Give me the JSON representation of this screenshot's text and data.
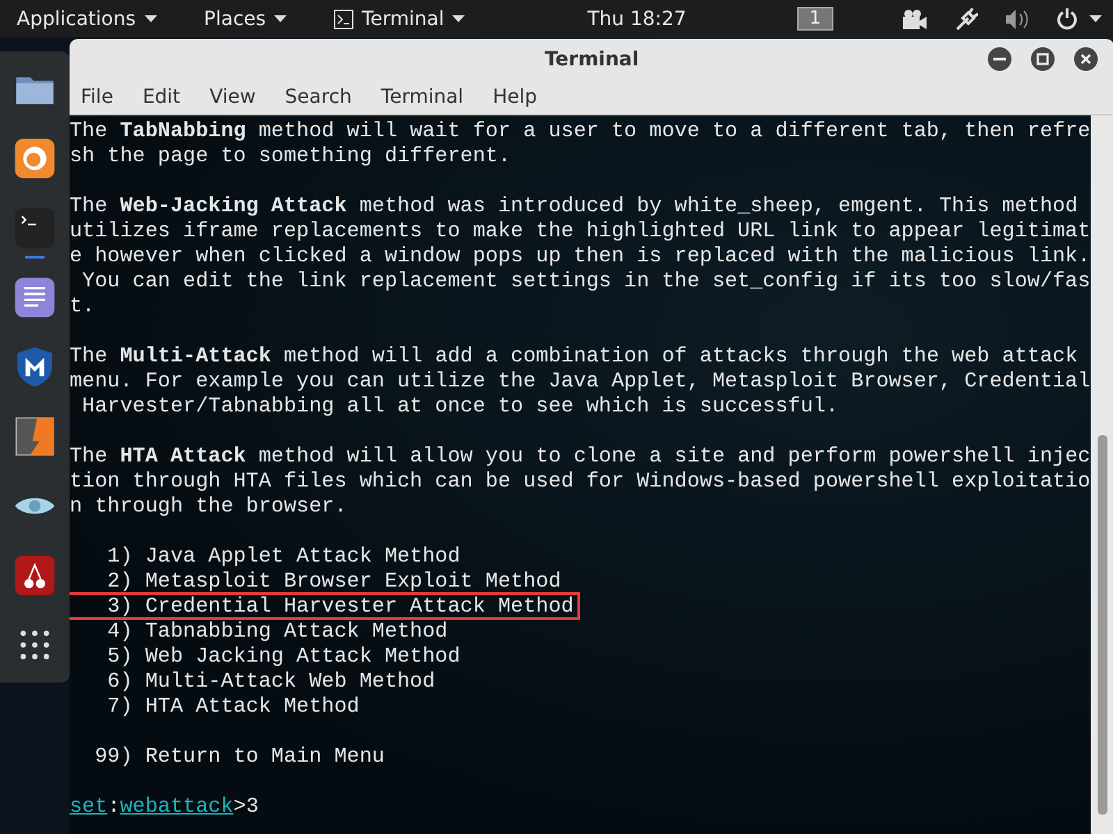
{
  "top_bar": {
    "menus": [
      {
        "label": "Applications",
        "kind": "menu"
      },
      {
        "label": "Places",
        "kind": "menu"
      },
      {
        "label": "Terminal",
        "kind": "app"
      }
    ],
    "clock": "Thu 18:27",
    "workspace": "1"
  },
  "dock": {
    "items": [
      {
        "kind": "folder",
        "running": false
      },
      {
        "kind": "browser",
        "running": false
      },
      {
        "kind": "terminal",
        "running": true
      },
      {
        "kind": "editor",
        "running": false
      },
      {
        "kind": "shield",
        "running": false
      },
      {
        "kind": "bolt",
        "running": false
      },
      {
        "kind": "eye",
        "running": false
      },
      {
        "kind": "cherry",
        "running": false
      },
      {
        "kind": "grid",
        "running": false
      }
    ]
  },
  "window": {
    "title": "Terminal",
    "menu": [
      "File",
      "Edit",
      "View",
      "Search",
      "Terminal",
      "Help"
    ]
  },
  "terminal": {
    "paragraphs": [
      {
        "lines": [
          "The **TabNabbing** method will wait for a user to move to a different tab, then refre",
          "sh the page to something different."
        ]
      },
      {
        "lines": [
          "The **Web-Jacking Attack** method was introduced by white_sheep, emgent. This method",
          "utilizes iframe replacements to make the highlighted URL link to appear legitimat",
          "e however when clicked a window pops up then is replaced with the malicious link.",
          " You can edit the link replacement settings in the set_config if its too slow/fas",
          "t."
        ]
      },
      {
        "lines": [
          "The **Multi-Attack** method will add a combination of attacks through the web attack",
          "menu. For example you can utilize the Java Applet, Metasploit Browser, Credential",
          " Harvester/Tabnabbing all at once to see which is successful."
        ]
      },
      {
        "lines": [
          "The **HTA Attack** method will allow you to clone a site and perform powershell injec",
          "tion through HTA files which can be used for Windows-based powershell exploitatio",
          "n through the browser."
        ]
      }
    ],
    "menu_items": [
      {
        "label": "   1) Java Applet Attack Method",
        "selected": false
      },
      {
        "label": "   2) Metasploit Browser Exploit Method",
        "selected": false
      },
      {
        "label": "   3) Credential Harvester Attack Method",
        "selected": true
      },
      {
        "label": "   4) Tabnabbing Attack Method",
        "selected": false
      },
      {
        "label": "   5) Web Jacking Attack Method",
        "selected": false
      },
      {
        "label": "   6) Multi-Attack Web Method",
        "selected": false
      },
      {
        "label": "   7) HTA Attack Method",
        "selected": false
      }
    ],
    "return_item": "  99) Return to Main Menu",
    "prompt": {
      "module": "set",
      "separator": ":",
      "submodule": "webattack",
      "input": ">3"
    }
  }
}
